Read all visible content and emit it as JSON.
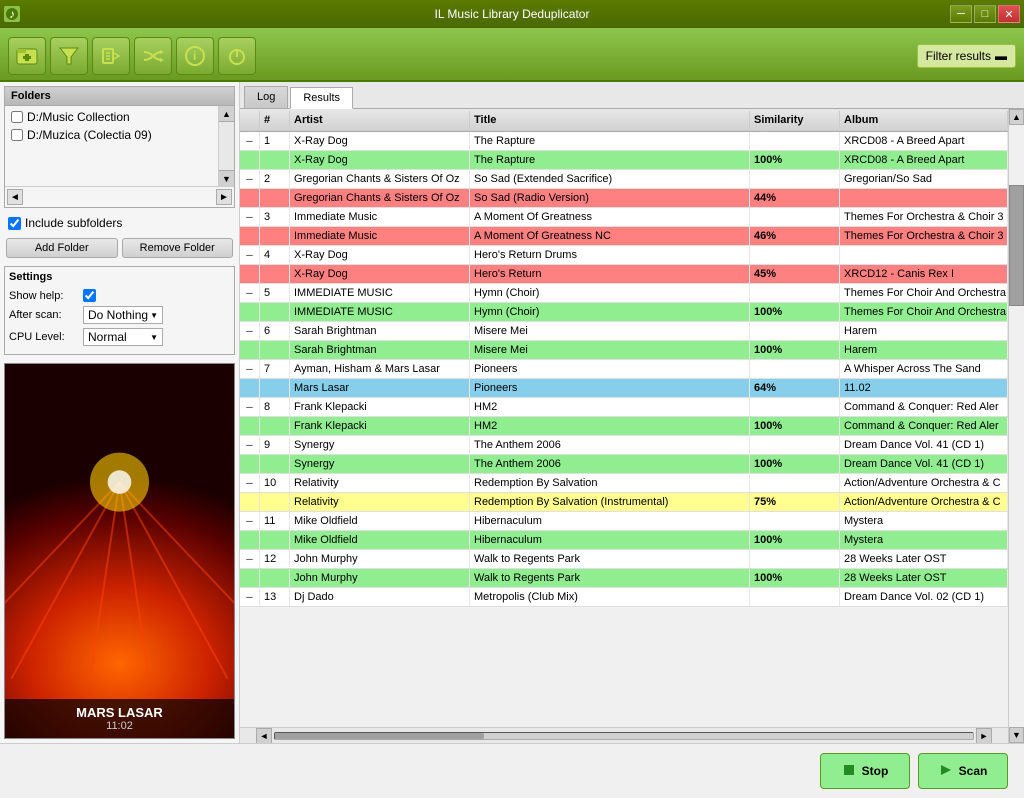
{
  "titlebar": {
    "title": "IL Music Library Deduplicator",
    "icon": "♪",
    "minimize": "─",
    "restore": "□",
    "close": "✕"
  },
  "toolbar": {
    "filter_label": "Filter results",
    "filter_icon": "▬",
    "buttons": [
      {
        "name": "add-folder-btn",
        "icon": "📁",
        "label": "+"
      },
      {
        "name": "filter-btn",
        "icon": "🔽",
        "label": "▽"
      },
      {
        "name": "tag-btn",
        "icon": "🏷",
        "label": "✎"
      },
      {
        "name": "shuffle-btn",
        "icon": "⇄",
        "label": "⇄"
      },
      {
        "name": "info-btn",
        "icon": "ℹ",
        "label": "ℹ"
      },
      {
        "name": "power-btn",
        "icon": "⏻",
        "label": "⏻"
      }
    ]
  },
  "folders": {
    "header": "Folders",
    "items": [
      {
        "path": "D:/Music Collection",
        "checked": false
      },
      {
        "path": "D:/Muzica (Colectia 09)",
        "checked": false
      }
    ],
    "include_subfolders_label": "Include subfolders",
    "include_subfolders_checked": true,
    "add_folder_label": "Add Folder",
    "remove_folder_label": "Remove Folder"
  },
  "settings": {
    "header": "Settings",
    "show_help_label": "Show help:",
    "show_help_checked": true,
    "after_scan_label": "After scan:",
    "after_scan_value": "Do Nothing",
    "cpu_level_label": "CPU Level:",
    "cpu_level_value": "Normal"
  },
  "album_art": {
    "title": "MARS LASAR",
    "subtitle": "11:02"
  },
  "tabs": {
    "log_label": "Log",
    "results_label": "Results"
  },
  "table": {
    "headers": [
      "",
      "#",
      "Artist",
      "Title",
      "Similarity",
      "Album"
    ],
    "rows": [
      {
        "group": 1,
        "main": {
          "num": "1",
          "artist": "X-Ray Dog",
          "title": "The Rapture",
          "similarity": "",
          "album": "XRCD08 - A Breed Apart"
        },
        "dup": {
          "artist": "X-Ray Dog",
          "title": "The Rapture",
          "similarity": "100%",
          "album": "XRCD08 - A Breed Apart",
          "color": "green"
        }
      },
      {
        "group": 2,
        "main": {
          "num": "2",
          "artist": "Gregorian Chants & Sisters Of Oz",
          "title": "So Sad (Extended Sacrifice)",
          "similarity": "",
          "album": "Gregorian/So Sad"
        },
        "dup": {
          "artist": "Gregorian Chants & Sisters Of Oz",
          "title": "So Sad (Radio Version)",
          "similarity": "44%",
          "album": "",
          "color": "red"
        }
      },
      {
        "group": 3,
        "main": {
          "num": "3",
          "artist": "Immediate Music",
          "title": "A Moment Of Greatness",
          "similarity": "",
          "album": "Themes For Orchestra & Choir 3"
        },
        "dup": {
          "artist": "Immediate Music",
          "title": "A Moment Of Greatness NC",
          "similarity": "46%",
          "album": "Themes For Orchestra & Choir 3",
          "color": "red"
        }
      },
      {
        "group": 4,
        "main": {
          "num": "4",
          "artist": "X-Ray Dog",
          "title": "Hero's Return Drums",
          "similarity": "",
          "album": ""
        },
        "dup": {
          "artist": "X-Ray Dog",
          "title": "Hero's Return",
          "similarity": "45%",
          "album": "XRCD12 - Canis Rex I",
          "color": "red"
        }
      },
      {
        "group": 5,
        "main": {
          "num": "5",
          "artist": "IMMEDIATE MUSIC",
          "title": "Hymn (Choir)",
          "similarity": "",
          "album": "Themes For Choir And Orchestra"
        },
        "dup": {
          "artist": "IMMEDIATE MUSIC",
          "title": "Hymn (Choir)",
          "similarity": "100%",
          "album": "Themes For Choir And Orchestra",
          "color": "green"
        }
      },
      {
        "group": 6,
        "main": {
          "num": "6",
          "artist": "Sarah Brightman",
          "title": "Misere Mei",
          "similarity": "",
          "album": "Harem"
        },
        "dup": {
          "artist": "Sarah Brightman",
          "title": "Misere Mei",
          "similarity": "100%",
          "album": "Harem",
          "color": "green"
        }
      },
      {
        "group": 7,
        "main": {
          "num": "7",
          "artist": "Ayman, Hisham & Mars Lasar",
          "title": "Pioneers",
          "similarity": "",
          "album": "A Whisper Across The Sand"
        },
        "dup": {
          "artist": "Mars Lasar",
          "title": "Pioneers",
          "similarity": "64%",
          "album": "11.02",
          "color": "blue"
        }
      },
      {
        "group": 8,
        "main": {
          "num": "8",
          "artist": "Frank Klepacki",
          "title": "HM2",
          "similarity": "",
          "album": "Command & Conquer: Red Aler"
        },
        "dup": {
          "artist": "Frank Klepacki",
          "title": "HM2",
          "similarity": "100%",
          "album": "Command & Conquer: Red Aler",
          "color": "green"
        }
      },
      {
        "group": 9,
        "main": {
          "num": "9",
          "artist": "Synergy",
          "title": "The Anthem 2006",
          "similarity": "",
          "album": "Dream Dance Vol. 41 (CD 1)"
        },
        "dup": {
          "artist": "Synergy",
          "title": "The Anthem 2006",
          "similarity": "100%",
          "album": "Dream Dance Vol. 41 (CD 1)",
          "color": "green"
        }
      },
      {
        "group": 10,
        "main": {
          "num": "10",
          "artist": "Relativity",
          "title": "Redemption By Salvation",
          "similarity": "",
          "album": "Action/Adventure Orchestra & C"
        },
        "dup": {
          "artist": "Relativity",
          "title": "Redemption By Salvation (Instrumental)",
          "similarity": "75%",
          "album": "Action/Adventure Orchestra & C",
          "color": "yellow"
        }
      },
      {
        "group": 11,
        "main": {
          "num": "11",
          "artist": "Mike Oldfield",
          "title": "Hibernaculum",
          "similarity": "",
          "album": "Mystera"
        },
        "dup": {
          "artist": "Mike Oldfield",
          "title": "Hibernaculum",
          "similarity": "100%",
          "album": "Mystera",
          "color": "green"
        }
      },
      {
        "group": 12,
        "main": {
          "num": "12",
          "artist": "John Murphy",
          "title": "Walk to Regents Park",
          "similarity": "",
          "album": "28 Weeks Later OST"
        },
        "dup": {
          "artist": "John Murphy",
          "title": "Walk to Regents Park",
          "similarity": "100%",
          "album": "28 Weeks Later OST",
          "color": "green"
        }
      },
      {
        "group": 13,
        "main": {
          "num": "13",
          "artist": "Dj Dado",
          "title": "Metropolis (Club Mix)",
          "similarity": "",
          "album": "Dream Dance Vol. 02 (CD 1)"
        },
        "dup": null
      }
    ]
  },
  "buttons": {
    "stop_label": "Stop",
    "scan_label": "Scan"
  }
}
